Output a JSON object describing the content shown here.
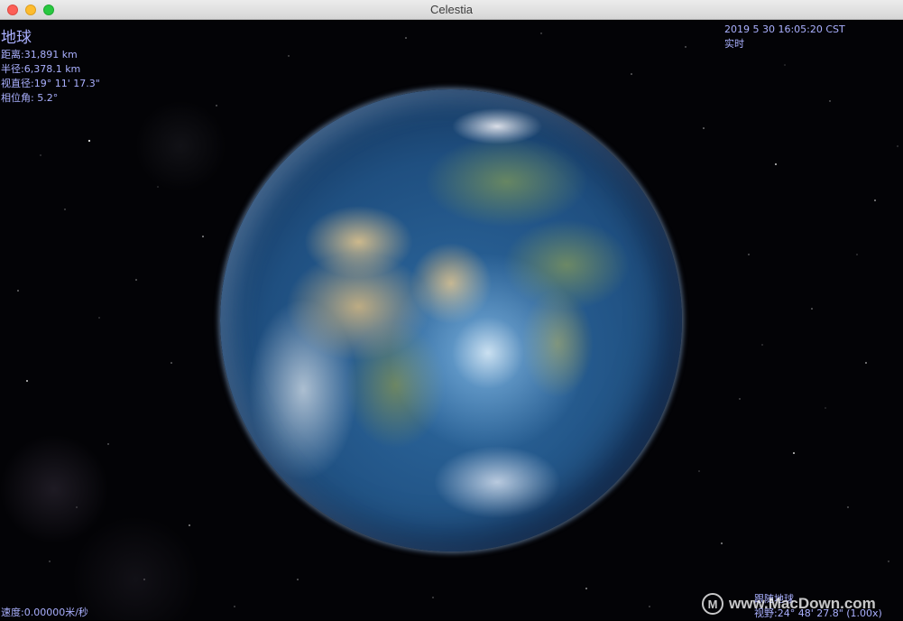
{
  "window": {
    "title": "Celestia"
  },
  "object_info": {
    "name": "地球",
    "distance": "距离:31,891 km",
    "radius": "半径:6,378.1 km",
    "apparent_diameter": "视直径:19° 11' 17.3\"",
    "phase_angle": "相位角: 5.2°"
  },
  "time_info": {
    "datetime": "2019  5 30 16:05:20 CST",
    "mode": "实时"
  },
  "speed": "速度:0.00000米/秒",
  "view_info": {
    "tracking": "跟随地球",
    "fov": "视野:24° 48' 27.8\" (1.00x)"
  },
  "watermark": {
    "logo_letter": "M",
    "text": "www.MacDown.com"
  },
  "colors": {
    "hud_text": "#aab0ff",
    "space": "#030306"
  },
  "icons": {
    "close": "close-icon",
    "minimize": "minimize-icon",
    "maximize": "maximize-icon",
    "watermark_logo": "macdown-logo-icon"
  }
}
